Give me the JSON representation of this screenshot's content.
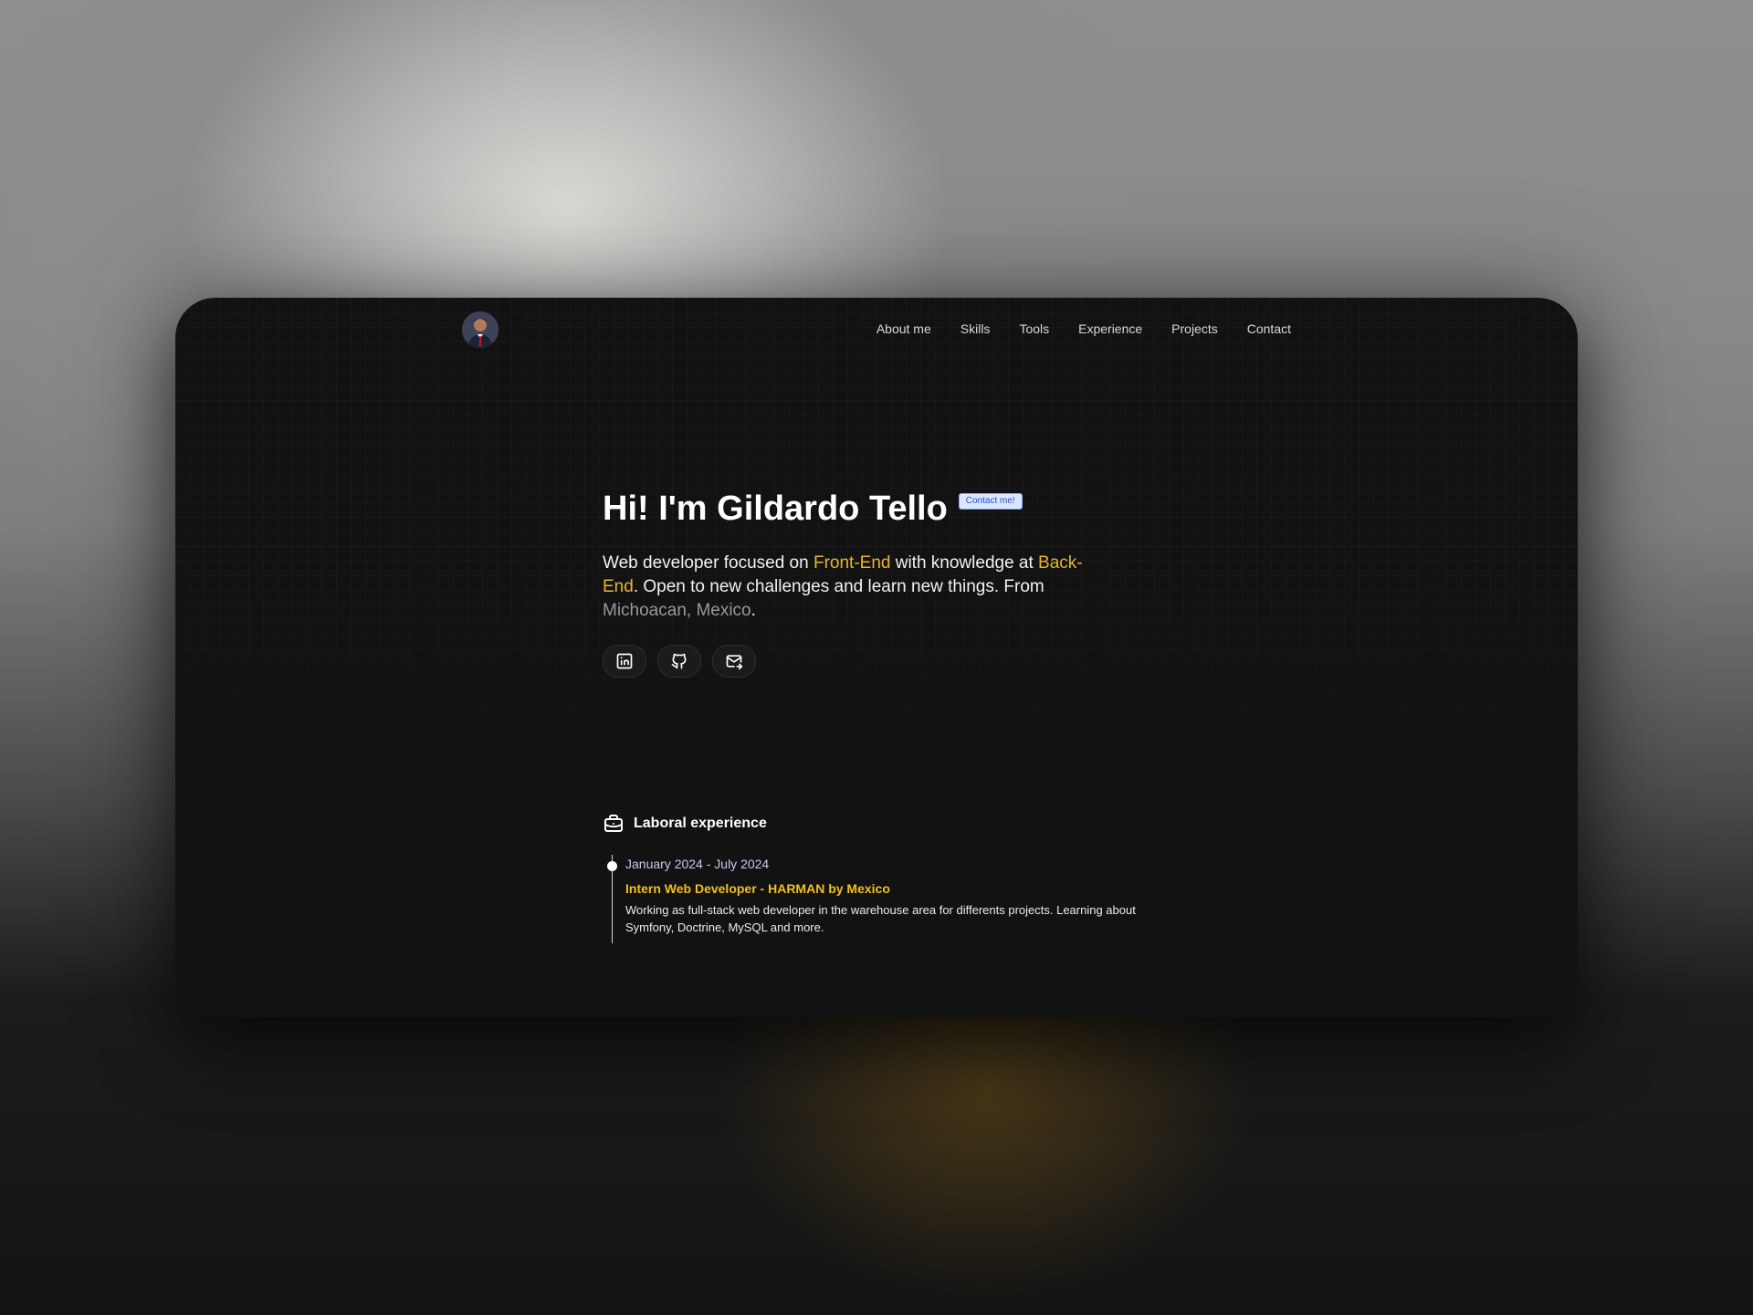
{
  "nav": {
    "items": [
      "About me",
      "Skills",
      "Tools",
      "Experience",
      "Projects",
      "Contact"
    ]
  },
  "hero": {
    "title": "Hi! I'm Gildardo Tello",
    "badge": "Contact me!",
    "desc": {
      "part1": "Web developer focused on ",
      "frontend": "Front-End",
      "part2": " with knowledge at ",
      "backend": "Back-End",
      "part3": ". Open to new challenges and learn new things. From ",
      "location": "Michoacan, Mexico",
      "part4": "."
    }
  },
  "socials": {
    "icons": [
      "linkedin-icon",
      "github-icon",
      "mail-icon"
    ]
  },
  "experience": {
    "heading": "Laboral experience",
    "items": [
      {
        "date": "January 2024 - July 2024",
        "role": "Intern Web Developer - HARMAN by Mexico",
        "desc": "Working as full-stack web developer in the warehouse area for differents projects. Learning about Symfony, Doctrine, MySQL and more."
      }
    ]
  },
  "colors": {
    "accent": "#e8b62a",
    "role": "#f0c020",
    "date": "#c7caf2",
    "card": "#121212"
  }
}
